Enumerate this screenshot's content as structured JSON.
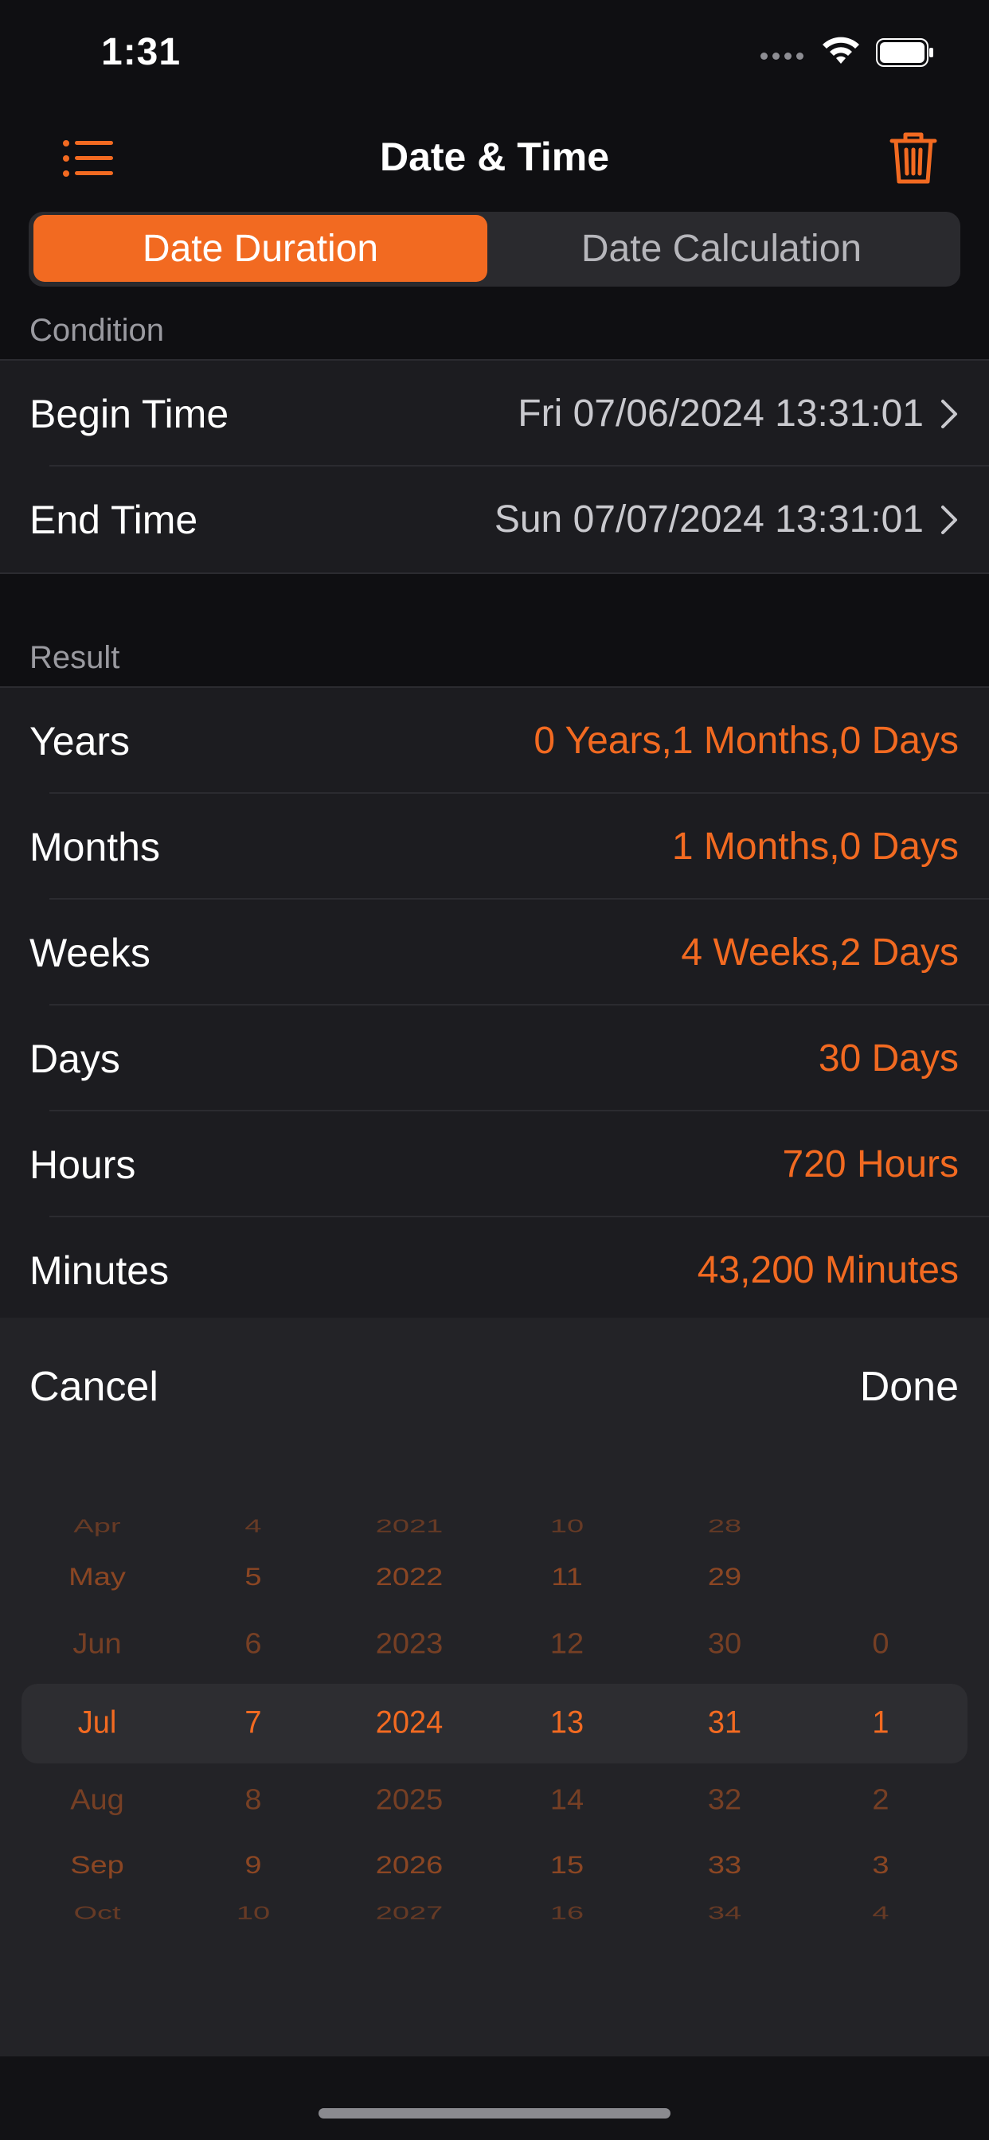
{
  "status": {
    "time": "1:31"
  },
  "nav": {
    "title": "Date & Time",
    "menu_icon": "list-icon",
    "delete_icon": "trash-icon"
  },
  "segments": {
    "active": "Date Duration",
    "inactive": "Date Calculation"
  },
  "condition": {
    "header": "Condition",
    "rows": [
      {
        "label": "Begin Time",
        "value": "Fri 07/06/2024 13:31:01"
      },
      {
        "label": "End Time",
        "value": "Sun 07/07/2024 13:31:01"
      }
    ]
  },
  "result": {
    "header": "Result",
    "rows": [
      {
        "label": "Years",
        "value": "0 Years,1 Months,0 Days"
      },
      {
        "label": "Months",
        "value": "1 Months,0 Days"
      },
      {
        "label": "Weeks",
        "value": "4 Weeks,2 Days"
      },
      {
        "label": "Days",
        "value": "30 Days"
      },
      {
        "label": "Hours",
        "value": "720 Hours"
      },
      {
        "label": "Minutes",
        "value": "43,200 Minutes"
      }
    ]
  },
  "picker": {
    "cancel": "Cancel",
    "done": "Done",
    "columns": [
      [
        "Apr",
        "May",
        "Jun",
        "Jul",
        "Aug",
        "Sep",
        "Oct"
      ],
      [
        "4",
        "5",
        "6",
        "7",
        "8",
        "9",
        "10"
      ],
      [
        "2021",
        "2022",
        "2023",
        "2024",
        "2025",
        "2026",
        "2027"
      ],
      [
        "10",
        "11",
        "12",
        "13",
        "14",
        "15",
        "16"
      ],
      [
        "28",
        "29",
        "30",
        "31",
        "32",
        "33",
        "34"
      ],
      [
        "",
        "",
        "0",
        "1",
        "2",
        "3",
        "4"
      ]
    ]
  },
  "colors": {
    "accent": "#f26a21",
    "background": "#0f0f12",
    "cell": "#1c1c20"
  }
}
